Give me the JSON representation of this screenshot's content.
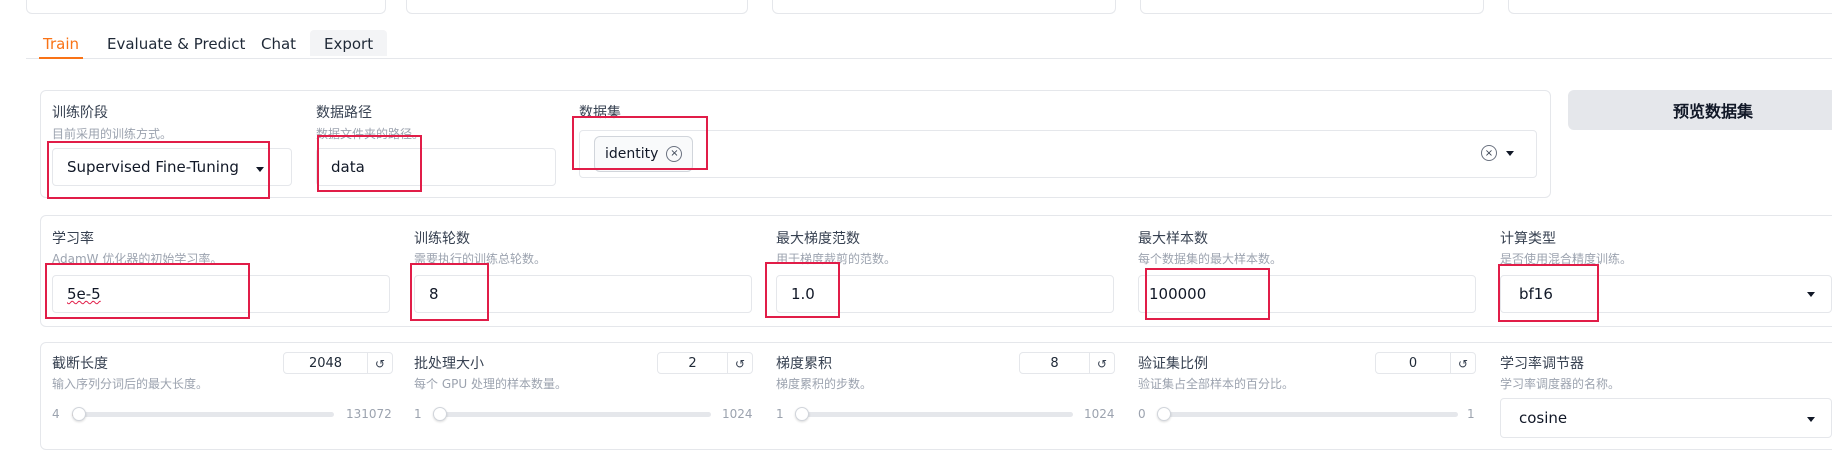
{
  "tabs": [
    {
      "label": "Train"
    },
    {
      "label": "Evaluate & Predict"
    },
    {
      "label": "Chat"
    },
    {
      "label": "Export"
    }
  ],
  "row1": {
    "stage": {
      "label": "训练阶段",
      "info": "目前采用的训练方式。",
      "value": "Supervised Fine-Tuning"
    },
    "data_dir": {
      "label": "数据路径",
      "info": "数据文件夹的路径。",
      "value": "data"
    },
    "dataset": {
      "label": "数据集",
      "chip": "identity"
    },
    "preview_button": "预览数据集"
  },
  "row2": {
    "learning_rate": {
      "label": "学习率",
      "info": "AdamW 优化器的初始学习率。",
      "value": "5e-5"
    },
    "epochs": {
      "label": "训练轮数",
      "info": "需要执行的训练总轮数。",
      "value": "8"
    },
    "max_grad_norm": {
      "label": "最大梯度范数",
      "info": "用于梯度裁剪的范数。",
      "value": "1.0"
    },
    "max_samples": {
      "label": "最大样本数",
      "info": "每个数据集的最大样本数。",
      "value": "100000"
    },
    "compute_type": {
      "label": "计算类型",
      "info": "是否使用混合精度训练。",
      "value": "bf16"
    }
  },
  "row3": {
    "cutoff_len": {
      "label": "截断长度",
      "info": "输入序列分词后的最大长度。",
      "value": "2048",
      "min": "4",
      "max": "131072",
      "fraction": 0.015
    },
    "batch_size": {
      "label": "批处理大小",
      "info": "每个 GPU 处理的样本数量。",
      "value": "2",
      "min": "1",
      "max": "1024",
      "fraction": 0.001
    },
    "grad_accum": {
      "label": "梯度累积",
      "info": "梯度累积的步数。",
      "value": "8",
      "min": "1",
      "max": "1024",
      "fraction": 0.007
    },
    "val_size": {
      "label": "验证集比例",
      "info": "验证集占全部样本的百分比。",
      "value": "0",
      "min": "0",
      "max": "1",
      "fraction": 0
    },
    "lr_scheduler": {
      "label": "学习率调节器",
      "info": "学习率调度器的名称。",
      "value": "cosine"
    }
  },
  "icons": {
    "reset": "↺",
    "clear": "×"
  },
  "colors": {
    "accent": "#f97316",
    "highlight": "#e11d48"
  }
}
